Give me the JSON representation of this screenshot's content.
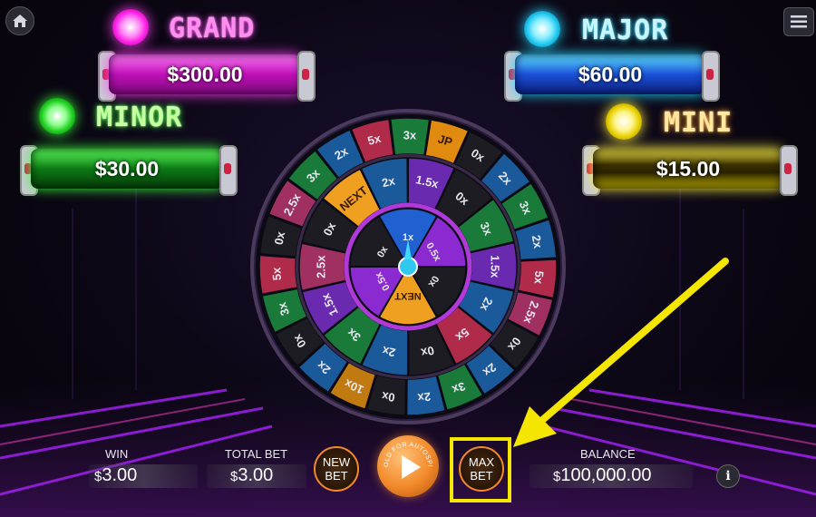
{
  "jackpots": {
    "grand": {
      "label": "GRAND",
      "value": "$300.00",
      "color": "#ff3df2"
    },
    "major": {
      "label": "MAJOR",
      "value": "$60.00",
      "color": "#22d8ff"
    },
    "minor": {
      "label": "MINOR",
      "value": "$30.00",
      "color": "#3aff3a"
    },
    "mini": {
      "label": "MINI",
      "value": "$15.00",
      "color": "#fff23a"
    }
  },
  "wheel": {
    "inner": [
      "1x",
      "0.5x",
      "0x",
      "NEXT",
      "0.5x",
      "0x"
    ],
    "middle": [
      "NEXT",
      "2x",
      "1.5x",
      "0x",
      "3x",
      "1.5x",
      "2x",
      "5x",
      "0x",
      "2x",
      "3x",
      "1.5x",
      "2.5x",
      "0x"
    ],
    "outer": [
      "JP",
      "0x",
      "2x",
      "3x",
      "2x",
      "5x",
      "2.5x",
      "0x",
      "2x",
      "3x",
      "2x",
      "0x",
      "10x",
      "2x",
      "0x",
      "3x",
      "5x",
      "0x",
      "2.5x",
      "3x",
      "2x",
      "5x",
      "3x"
    ]
  },
  "bottom": {
    "win_label": "WIN",
    "win_currency": "$",
    "win_value": "3.00",
    "total_bet_label": "TOTAL BET",
    "total_bet_currency": "$",
    "total_bet_value": "3.00",
    "new_bet_line1": "NEW",
    "new_bet_line2": "BET",
    "spin_hint": "HOLD FOR AUTOSPIN",
    "max_bet_line1": "MAX",
    "max_bet_line2": "BET",
    "balance_label": "BALANCE",
    "balance_currency": "$",
    "balance_value": "100,000.00",
    "info_icon_glyph": "i"
  },
  "colors": {
    "highlight": "#f4e600",
    "spin": "#f2892a"
  }
}
